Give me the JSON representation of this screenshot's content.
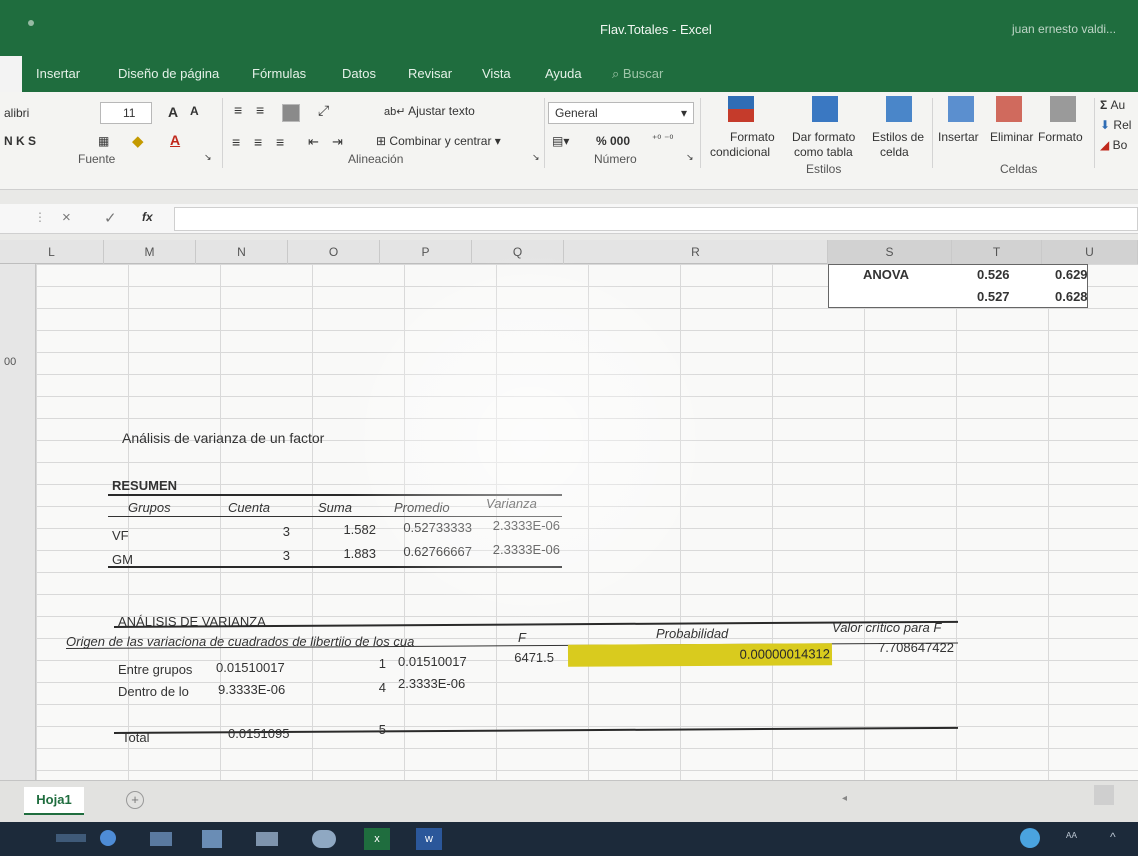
{
  "window": {
    "title": "Flav.Totales - Excel",
    "user": "juan ernesto valdi..."
  },
  "tabs": [
    {
      "label": "Insertar"
    },
    {
      "label": "Diseño de página"
    },
    {
      "label": "Fórmulas"
    },
    {
      "label": "Datos"
    },
    {
      "label": "Revisar"
    },
    {
      "label": "Vista"
    },
    {
      "label": "Ayuda"
    },
    {
      "label": "Buscar"
    }
  ],
  "ribbon": {
    "font_name": "alibri",
    "font_size": "11",
    "bold_italic_underline": "N  K  S",
    "group_fuente": "Fuente",
    "wrap_text": "Ajustar texto",
    "merge_center": "Combinar y centrar",
    "group_alineacion": "Alineación",
    "number_format": "General",
    "percent_thousands": "%  000",
    "group_numero": "Número",
    "cond_format_1": "Formato",
    "cond_format_2": "condicional",
    "table_format_1": "Dar formato",
    "table_format_2": "como tabla",
    "cell_styles_1": "Estilos de",
    "cell_styles_2": "celda",
    "group_estilos": "Estilos",
    "insert_label": "Insertar",
    "delete_label": "Eliminar",
    "format_label": "Formato",
    "group_celdas": "Celdas",
    "autosum": "Au",
    "fill": "Rel",
    "clear": "Bo"
  },
  "formula_bar": {
    "cancel": "×",
    "enter": "✓",
    "fx": "fx"
  },
  "columns": [
    "L",
    "M",
    "N",
    "O",
    "P",
    "Q",
    "R",
    "S",
    "T",
    "U"
  ],
  "row_stub": "00",
  "anova_box": {
    "label": "ANOVA",
    "r1c1": "0.526",
    "r1c2": "0.629",
    "r2c1": "0.527",
    "r2c2": "0.628"
  },
  "analysis": {
    "title": "Análisis de varianza de un factor",
    "resumen": {
      "title": "RESUMEN",
      "headers": [
        "Grupos",
        "Cuenta",
        "Suma",
        "Promedio",
        "Varianza"
      ],
      "rows": [
        [
          "VF",
          "3",
          "1.582",
          "0.52733333",
          "2.3333E-06"
        ],
        [
          "GM",
          "3",
          "1.883",
          "0.62766667",
          "2.3333E-06"
        ]
      ]
    },
    "anova": {
      "title": "ANÁLISIS DE VARIANZA",
      "header_origin": "Origen de las variaciona de cuadrados de libertiio de los cua",
      "header_f": "F",
      "header_prob": "Probabilidad",
      "header_crit": "Valor crítico para F",
      "between_label": "Entre grupos",
      "between_ss": "0.01510017",
      "between_df": "1",
      "between_ms": "0.01510017",
      "between_f": "6471.5",
      "between_prob": "0.00000014312",
      "between_crit": "7.708647422",
      "within_label": "Dentro de lo",
      "within_ss": "9.3333E-06",
      "within_df": "4",
      "within_ms": "2.3333E-06",
      "total_label": "Total",
      "total_ss": "0.0151095",
      "total_df": "5"
    }
  },
  "sheet": {
    "tab": "Hoja1",
    "add": "+"
  },
  "colors": {
    "excel_green": "#1f6d3e",
    "highlight": "#d9cb1e"
  }
}
